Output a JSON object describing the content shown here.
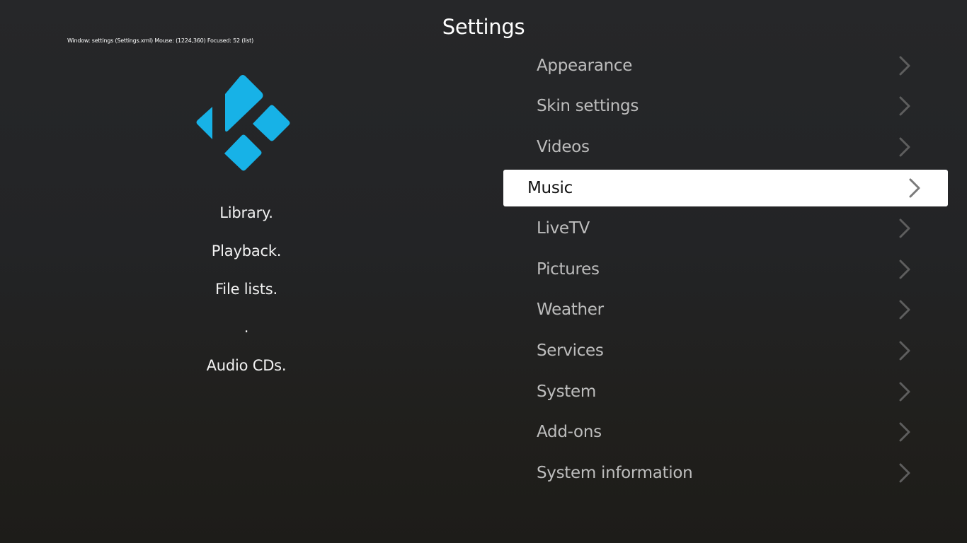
{
  "debug": {
    "text": "Window: settings (Settings.xml)  Mouse: (1224,360)  Focused: 52 (list)"
  },
  "header": {
    "title": "Settings"
  },
  "logo": {
    "icon": "kodi-logo-icon",
    "color": "#17b2e7"
  },
  "description": {
    "lines": [
      "Library.",
      "Playback.",
      "File lists.",
      ".",
      "Audio CDs."
    ]
  },
  "menu": {
    "focused_index": 3,
    "items": [
      {
        "label": "Appearance"
      },
      {
        "label": "Skin settings"
      },
      {
        "label": "Videos"
      },
      {
        "label": "Music"
      },
      {
        "label": "LiveTV"
      },
      {
        "label": "Pictures"
      },
      {
        "label": "Weather"
      },
      {
        "label": "Services"
      },
      {
        "label": "System"
      },
      {
        "label": "Add-ons"
      },
      {
        "label": "System information"
      }
    ]
  }
}
